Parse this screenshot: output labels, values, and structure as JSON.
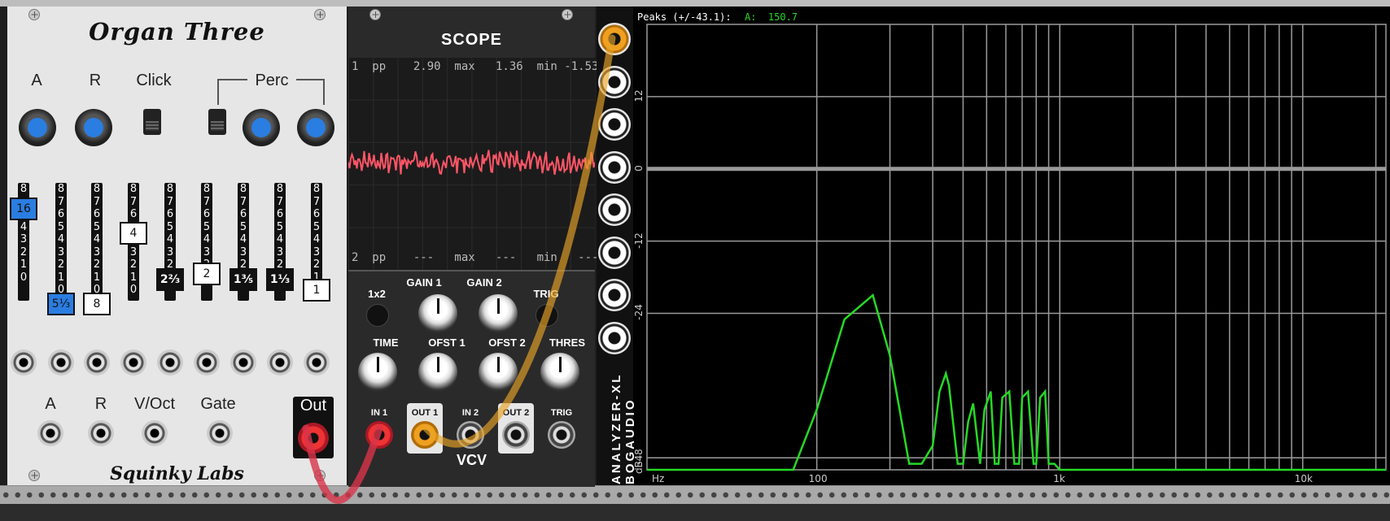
{
  "organ": {
    "title": "Organ Three",
    "labels": {
      "attack": "A",
      "release": "R",
      "click": "Click",
      "perc": "Perc"
    },
    "drawbars": [
      {
        "numbers": [
          "8",
          "",
          "5",
          "4",
          "3",
          "2",
          "1",
          "0"
        ],
        "handle": "16",
        "style": "blue"
      },
      {
        "numbers": [
          "8",
          "7",
          "6",
          "5",
          "4",
          "3",
          "2",
          "1",
          "0"
        ],
        "handle": "5⅓",
        "style": "blue"
      },
      {
        "numbers": [
          "8",
          "7",
          "6",
          "5",
          "4",
          "3",
          "2",
          "1",
          "0"
        ],
        "handle": "8",
        "style": "white"
      },
      {
        "numbers": [
          "8",
          "7",
          "6",
          "",
          "",
          "3",
          "2",
          "1",
          "0"
        ],
        "handle": "4",
        "style": "white"
      },
      {
        "numbers": [
          "8",
          "7",
          "6",
          "5",
          "4",
          "3",
          "2",
          "1"
        ],
        "handle": "2⅔",
        "style": "black"
      },
      {
        "numbers": [
          "8",
          "7",
          "6",
          "5",
          "4",
          "3",
          "2"
        ],
        "handle": "2",
        "style": "white"
      },
      {
        "numbers": [
          "8",
          "7",
          "6",
          "5",
          "4",
          "3",
          "2"
        ],
        "handle": "1⅗",
        "style": "black"
      },
      {
        "numbers": [
          "8",
          "7",
          "6",
          "5",
          "4",
          "3",
          "2"
        ],
        "handle": "1⅓",
        "style": "black"
      },
      {
        "numbers": [
          "8",
          "7",
          "6",
          "5",
          "4",
          "3",
          "2",
          "1"
        ],
        "handle": "1",
        "style": "white"
      }
    ],
    "inputs": {
      "a": "A",
      "r": "R",
      "voct": "V/Oct",
      "gate": "Gate"
    },
    "out": "Out",
    "brand": "Squinky Labs"
  },
  "scope": {
    "title": "SCOPE",
    "stat1": "1  pp    2.90  max   1.36  min -1.53",
    "stat2": "2  pp    ---   max   ---   min   ---",
    "controls": {
      "mode": "1x2",
      "gain1": "GAIN 1",
      "gain2": "GAIN 2",
      "trig": "TRIG",
      "time": "TIME",
      "ofst1": "OFST 1",
      "ofst2": "OFST 2",
      "thres": "THRES"
    },
    "ports": {
      "in1": "IN 1",
      "out1": "OUT 1",
      "in2": "IN 2",
      "out2": "OUT 2",
      "trig": "TRIG"
    },
    "brand": "VCV",
    "trace_color": "#ff5566"
  },
  "analyzer": {
    "name_line1": "ANALYZER-XL",
    "name_line2": "BOGAUDIO",
    "peaks_label": "Peaks (+/-43.1):",
    "peak_channel": "A:",
    "peak_value": "150.7",
    "y_labels": [
      "12",
      "0",
      "-12",
      "-24",
      "-48",
      "dB"
    ],
    "x_labels": [
      "Hz",
      "100",
      "1k",
      "10k"
    ],
    "trace_color": "#26d926",
    "spectrum": {
      "x_freq": [
        20,
        40,
        60,
        80,
        100,
        130,
        170,
        200,
        240,
        270,
        300,
        320,
        340,
        350,
        380,
        400,
        420,
        440,
        470,
        490,
        520,
        540,
        560,
        580,
        620,
        650,
        680,
        700,
        740,
        780,
        800,
        830,
        870,
        900,
        930,
        950,
        1000,
        1100,
        1200,
        1300,
        1600,
        4000,
        22000
      ],
      "y_db": [
        -50,
        -50,
        -50,
        -50,
        -40,
        -25,
        -21,
        -31,
        -49,
        -49,
        -46,
        -37,
        -34,
        -36,
        -49,
        -49,
        -42,
        -39,
        -49,
        -40,
        -37,
        -49,
        -49,
        -38,
        -37,
        -49,
        -49,
        -38,
        -37,
        -49,
        -49,
        -38,
        -37,
        -49,
        -49,
        -49,
        -50,
        -50,
        -50,
        -50,
        -50,
        -50,
        -50
      ]
    }
  }
}
